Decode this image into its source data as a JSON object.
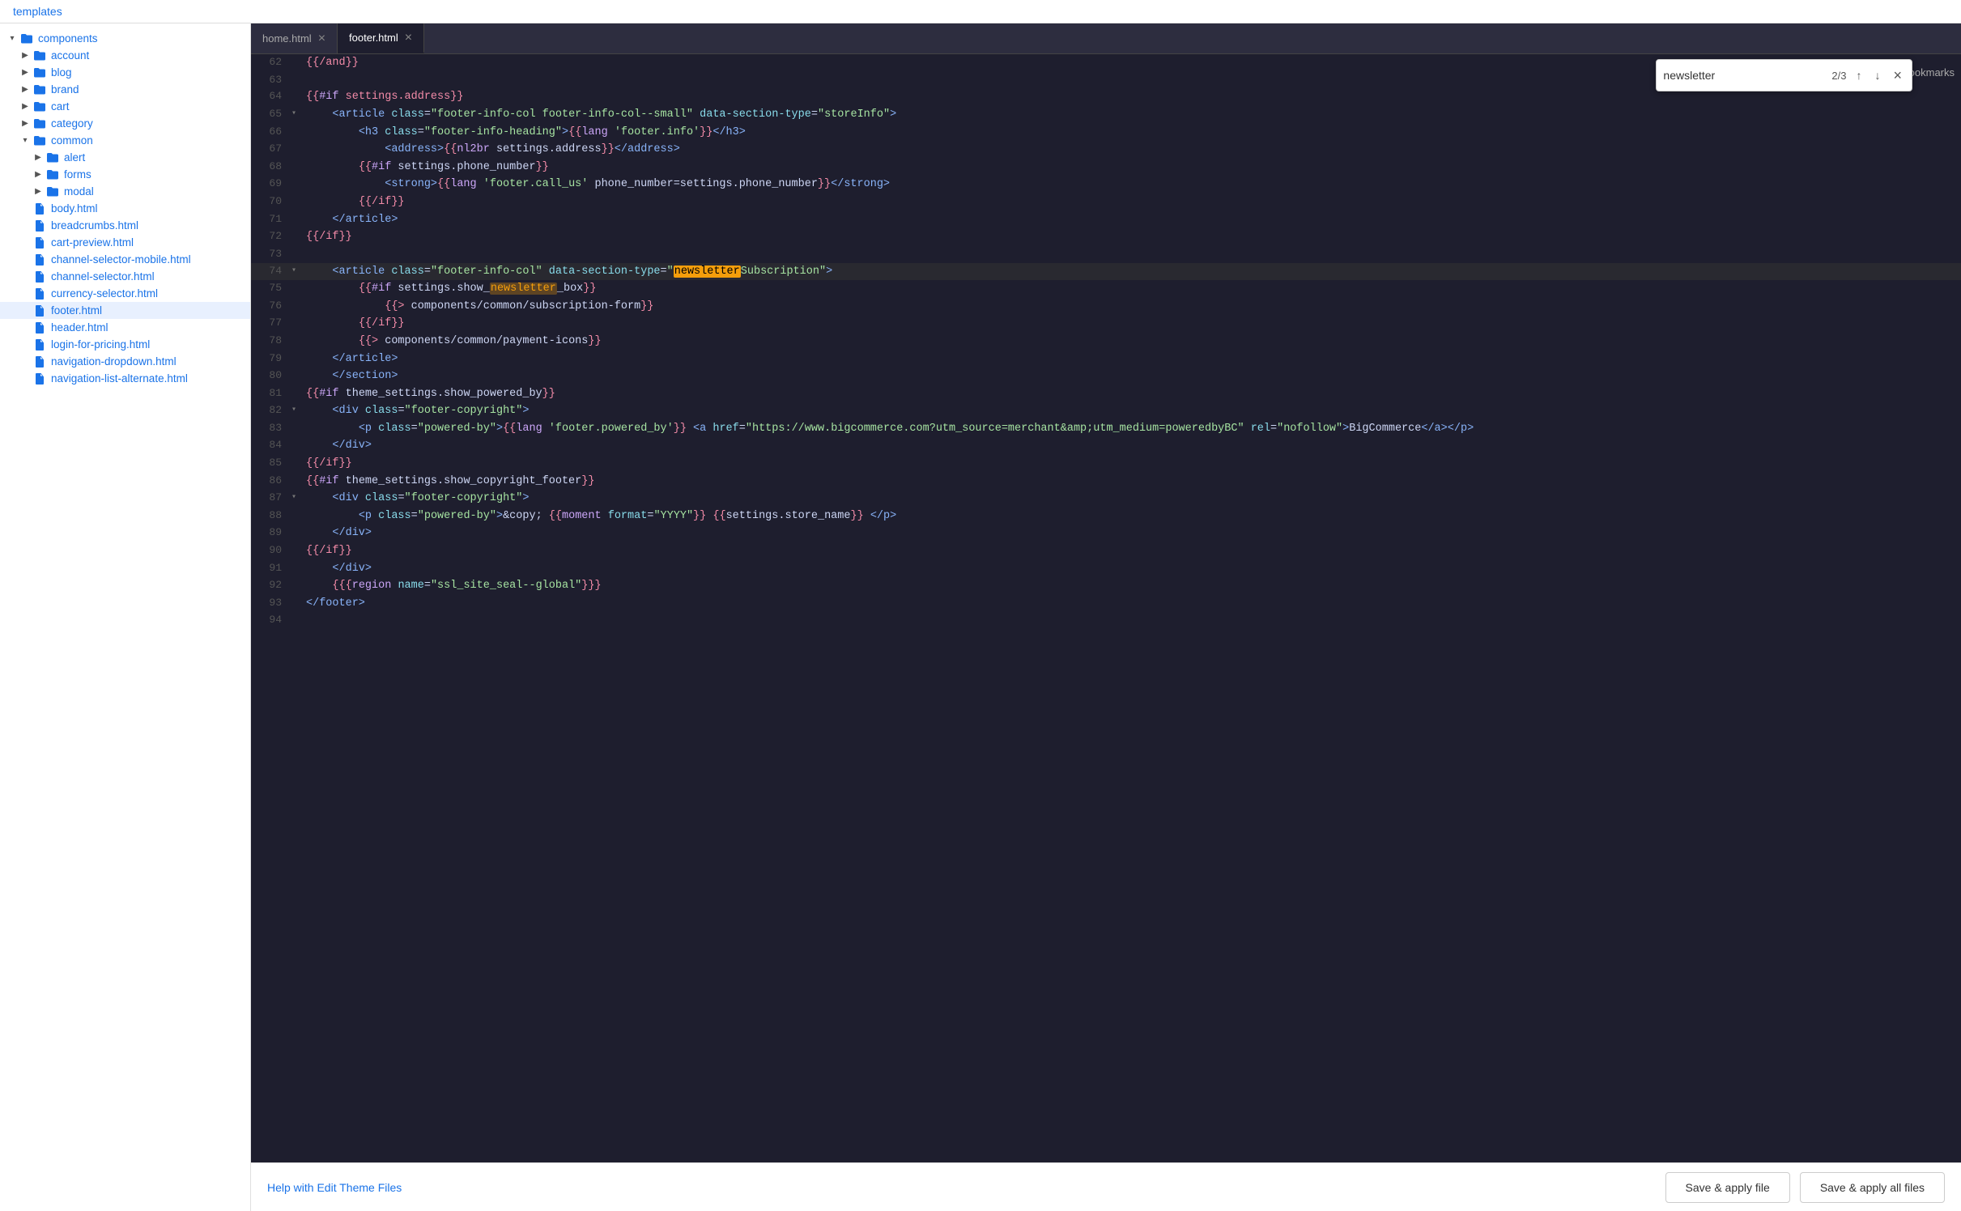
{
  "header": {
    "templates_label": "templates"
  },
  "sidebar": {
    "components_label": "components",
    "items": [
      {
        "id": "account",
        "label": "account",
        "type": "folder",
        "expanded": false,
        "indent": 2
      },
      {
        "id": "blog",
        "label": "blog",
        "type": "folder",
        "expanded": false,
        "indent": 2
      },
      {
        "id": "brand",
        "label": "brand",
        "type": "folder",
        "expanded": false,
        "indent": 2
      },
      {
        "id": "cart",
        "label": "cart",
        "type": "folder",
        "expanded": false,
        "indent": 2
      },
      {
        "id": "category",
        "label": "category",
        "type": "folder",
        "expanded": false,
        "indent": 2
      },
      {
        "id": "common",
        "label": "common",
        "type": "folder",
        "expanded": true,
        "indent": 2
      },
      {
        "id": "alert",
        "label": "alert",
        "type": "folder",
        "expanded": false,
        "indent": 3
      },
      {
        "id": "forms",
        "label": "forms",
        "type": "folder",
        "expanded": false,
        "indent": 3
      },
      {
        "id": "modal",
        "label": "modal",
        "type": "folder",
        "expanded": false,
        "indent": 3
      },
      {
        "id": "body.html",
        "label": "body.html",
        "type": "file",
        "indent": 2
      },
      {
        "id": "breadcrumbs.html",
        "label": "breadcrumbs.html",
        "type": "file",
        "indent": 2
      },
      {
        "id": "cart-preview.html",
        "label": "cart-preview.html",
        "type": "file",
        "indent": 2
      },
      {
        "id": "channel-selector-mobile.html",
        "label": "channel-selector-mobile.html",
        "type": "file",
        "indent": 2
      },
      {
        "id": "channel-selector.html",
        "label": "channel-selector.html",
        "type": "file",
        "indent": 2
      },
      {
        "id": "currency-selector.html",
        "label": "currency-selector.html",
        "type": "file",
        "indent": 2
      },
      {
        "id": "footer.html",
        "label": "footer.html",
        "type": "file",
        "indent": 2,
        "active": true
      },
      {
        "id": "header.html",
        "label": "header.html",
        "type": "file",
        "indent": 2
      },
      {
        "id": "login-for-pricing.html",
        "label": "login-for-pricing.html",
        "type": "file",
        "indent": 2
      },
      {
        "id": "navigation-dropdown.html",
        "label": "navigation-dropdown.html",
        "type": "file",
        "indent": 2
      },
      {
        "id": "navigation-list-alternate.html",
        "label": "navigation-list-alternate.html",
        "type": "file",
        "indent": 2
      }
    ]
  },
  "tabs": [
    {
      "id": "home.html",
      "label": "home.html",
      "closeable": true,
      "active": false
    },
    {
      "id": "footer.html",
      "label": "footer.html",
      "closeable": true,
      "active": true
    }
  ],
  "search": {
    "value": "newsletter",
    "count": "2/3",
    "up_label": "▲",
    "down_label": "▼",
    "close_label": "×",
    "all_bookmarks_label": "All Bookmarks"
  },
  "code_lines": [
    {
      "num": 62,
      "arrow": "",
      "content": "{{/and}}"
    },
    {
      "num": 63,
      "arrow": "",
      "content": ""
    },
    {
      "num": 64,
      "arrow": "",
      "content": "{{#if settings.address}}"
    },
    {
      "num": 65,
      "arrow": "▾",
      "content": "<article class=\"footer-info-col footer-info-col--small\" data-section-type=\"storeInfo\">"
    },
    {
      "num": 66,
      "arrow": "",
      "content": "    <h3 class=\"footer-info-heading\">{{lang 'footer.info'}}</h3>"
    },
    {
      "num": 67,
      "arrow": "",
      "content": "        <address>{{nl2br settings.address}}</address>"
    },
    {
      "num": 68,
      "arrow": "",
      "content": "        {{#if settings.phone_number}}"
    },
    {
      "num": 69,
      "arrow": "",
      "content": "            <strong>{{lang 'footer.call_us' phone_number=settings.phone_number}}</strong>"
    },
    {
      "num": 70,
      "arrow": "",
      "content": "        {{/if}}"
    },
    {
      "num": 71,
      "arrow": "",
      "content": "    </article>"
    },
    {
      "num": 72,
      "arrow": "",
      "content": "{{/if}}"
    },
    {
      "num": 73,
      "arrow": "",
      "content": ""
    },
    {
      "num": 74,
      "arrow": "▾",
      "content": "    <article class=\"footer-info-col\" data-section-type=\"newsletterSubscription\">",
      "highlight": true
    },
    {
      "num": 75,
      "arrow": "",
      "content": "        {{#if settings.show_newsletter_box}}"
    },
    {
      "num": 76,
      "arrow": "",
      "content": "            {{> components/common/subscription-form}}"
    },
    {
      "num": 77,
      "arrow": "",
      "content": "        {{/if}}"
    },
    {
      "num": 78,
      "arrow": "",
      "content": "        {{> components/common/payment-icons}}"
    },
    {
      "num": 79,
      "arrow": "",
      "content": "    </article>"
    },
    {
      "num": 80,
      "arrow": "",
      "content": "    </section>"
    },
    {
      "num": 81,
      "arrow": "",
      "content": "{{#if theme_settings.show_powered_by}}"
    },
    {
      "num": 82,
      "arrow": "▾",
      "content": "    <div class=\"footer-copyright\">"
    },
    {
      "num": 83,
      "arrow": "",
      "content": "        <p class=\"powered-by\">{{lang 'footer.powered_by'}} <a href=\"https://www.bigcommerce.com?utm_source=merchant&amp;utm_medium=poweredbyBC\" rel=\"nofollow\">BigCommerce</a></p>"
    },
    {
      "num": 84,
      "arrow": "",
      "content": "    </div>"
    },
    {
      "num": 85,
      "arrow": "",
      "content": "{{/if}}"
    },
    {
      "num": 86,
      "arrow": "",
      "content": "{{#if theme_settings.show_copyright_footer}}"
    },
    {
      "num": 87,
      "arrow": "▾",
      "content": "    <div class=\"footer-copyright\">"
    },
    {
      "num": 88,
      "arrow": "",
      "content": "        <p class=\"powered-by\">&copy; {{moment format=\"YYYY\"}} {{settings.store_name}} </p>"
    },
    {
      "num": 89,
      "arrow": "",
      "content": "    </div>"
    },
    {
      "num": 90,
      "arrow": "",
      "content": "{{/if}}"
    },
    {
      "num": 91,
      "arrow": "",
      "content": "    </div>"
    },
    {
      "num": 92,
      "arrow": "",
      "content": "    {{{region name=\"ssl_site_seal--global\"}}}"
    },
    {
      "num": 93,
      "arrow": "",
      "content": "</footer>"
    },
    {
      "num": 94,
      "arrow": "",
      "content": ""
    }
  ],
  "bottom": {
    "help_text": "Help with Edit Theme Files",
    "save_file_label": "Save & apply file",
    "save_all_label": "Save & apply all files"
  }
}
